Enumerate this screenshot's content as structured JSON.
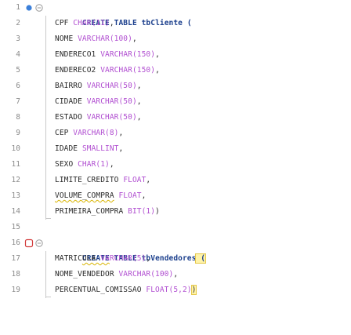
{
  "editor": {
    "line_numbers": [
      "1",
      "2",
      "3",
      "4",
      "5",
      "6",
      "7",
      "8",
      "9",
      "10",
      "11",
      "12",
      "13",
      "14",
      "15",
      "16",
      "17",
      "18",
      "19"
    ],
    "lines": [
      {
        "kw1": "CREATE",
        "kw2": "TABLE",
        "name": "tbCliente",
        "tail": " ("
      },
      {
        "col": "CPF",
        "type": "CHAR(11)",
        "end": ","
      },
      {
        "col": "NOME",
        "type": "VARCHAR(100)",
        "end": ","
      },
      {
        "col": "ENDERECO1",
        "type": "VARCHAR(150)",
        "end": ","
      },
      {
        "col": "ENDERECO2",
        "type": "VARCHAR(150)",
        "end": ","
      },
      {
        "col": "BAIRRO",
        "type": "VARCHAR(50)",
        "end": ","
      },
      {
        "col": "CIDADE",
        "type": "VARCHAR(50)",
        "end": ","
      },
      {
        "col": "ESTADO",
        "type": "VARCHAR(50)",
        "end": ","
      },
      {
        "col": "CEP",
        "type": "VARCHAR(8)",
        "end": ","
      },
      {
        "col": "IDADE",
        "type": "SMALLINT",
        "end": ","
      },
      {
        "col": "SEXO",
        "type": "CHAR(1)",
        "end": ","
      },
      {
        "col": "LIMITE_CREDITO",
        "type": "FLOAT",
        "end": ","
      },
      {
        "col": "VOLUME_COMPRA",
        "type": "FLOAT",
        "end": ","
      },
      {
        "col": "PRIMEIRA_COMPRA",
        "type": "BIT(1)",
        "end": ")"
      },
      {},
      {
        "kw1": "CREATE",
        "kw2": "TABLE",
        "name": "tbVendedores",
        "tail": " ("
      },
      {
        "col": "MATRICULA",
        "type": "VARCHAR(5)",
        "end": ","
      },
      {
        "col": "NOME_VENDEDOR",
        "type": "VARCHAR(100)",
        "end": ","
      },
      {
        "col": "PERCENTUAL_COMISSAO",
        "type": "FLOAT(5,2)",
        "end": ")"
      }
    ]
  },
  "colors": {
    "keyword": "#1a3e8c",
    "type": "#b14fd1",
    "line_number": "#8a8a8a",
    "highlight": "#fff3a8"
  }
}
